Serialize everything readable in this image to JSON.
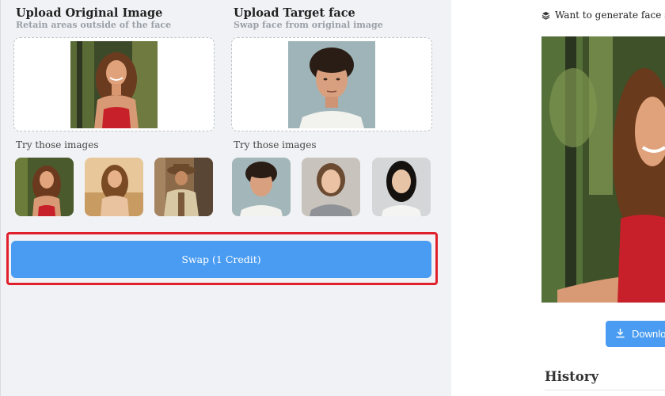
{
  "upload_original": {
    "title": "Upload Original Image",
    "subtitle": "Retain areas outside of the face",
    "try_label": "Try those images",
    "samples": [
      "sample-woman-forest",
      "sample-woman-field",
      "sample-man-hat"
    ]
  },
  "upload_target": {
    "title": "Upload Target face",
    "subtitle": "Swap face from original image",
    "try_label": "Try those images",
    "samples": [
      "sample-man-curly",
      "sample-woman-gray-top",
      "sample-woman-dark-hair"
    ]
  },
  "swap": {
    "label": "Swap (1 Credit)",
    "highlight_color": "#e0212b"
  },
  "result": {
    "promo_text": "Want to generate face swap",
    "download_label": "Downlo",
    "history_title": "History"
  },
  "colors": {
    "accent": "#4a9cf2",
    "panel_bg": "#f1f2f5",
    "highlight": "#e0212b"
  },
  "icons": {
    "promo": "stack-layers-icon",
    "download": "download-arrow-icon"
  }
}
